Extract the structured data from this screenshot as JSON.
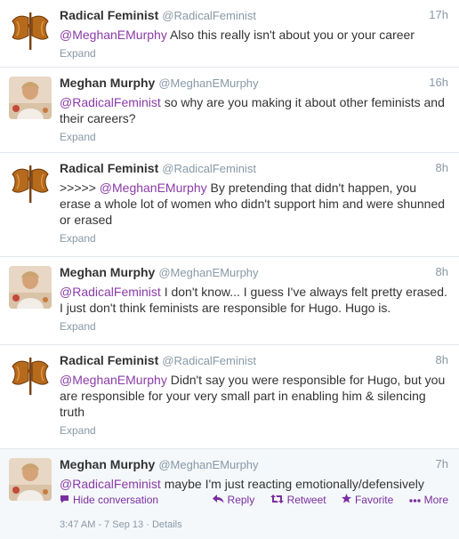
{
  "tweets": [
    {
      "name": "Radical Feminist",
      "handle": "@RadicalFeminist",
      "time": "17h",
      "prefix": "",
      "mention": "@MeghanEMurphy",
      "body": " Also this really isn't about you or your career",
      "expand": "Expand",
      "avatar": "labrys-icon"
    },
    {
      "name": "Meghan Murphy",
      "handle": "@MeghanEMurphy",
      "time": "16h",
      "prefix": "",
      "mention": "@RadicalFeminist",
      "body": " so why are you making it about other feminists and their careers?",
      "expand": "Expand",
      "avatar": "photo"
    },
    {
      "name": "Radical Feminist",
      "handle": "@RadicalFeminist",
      "time": "8h",
      "prefix": ">>>>> ",
      "mention": "@MeghanEMurphy",
      "body": " By pretending that didn't happen, you erase a whole lot of women who didn't support him and were shunned or erased",
      "expand": "Expand",
      "avatar": "labrys-icon"
    },
    {
      "name": "Meghan Murphy",
      "handle": "@MeghanEMurphy",
      "time": "8h",
      "prefix": "",
      "mention": "@RadicalFeminist",
      "body": " I don't know... I guess I've always felt pretty erased. I just don't think feminists are responsible for Hugo. Hugo is.",
      "expand": "Expand",
      "avatar": "photo"
    },
    {
      "name": "Radical Feminist",
      "handle": "@RadicalFeminist",
      "time": "8h",
      "prefix": "",
      "mention": "@MeghanEMurphy",
      "body": " Didn't say you were responsible for Hugo, but you are responsible for your very small part in enabling him & silencing truth",
      "expand": "Expand",
      "avatar": "labrys-icon"
    },
    {
      "name": "Meghan Murphy",
      "handle": "@MeghanEMurphy",
      "time": "7h",
      "prefix": "",
      "mention": "@RadicalFeminist",
      "body": " maybe I'm just reacting emotionally/defensively",
      "expand": "",
      "avatar": "photo"
    }
  ],
  "actions": {
    "hide": "Hide conversation",
    "reply": "Reply",
    "retweet": "Retweet",
    "favorite": "Favorite",
    "more": "More"
  },
  "footer": {
    "timestamp": "3:47 AM - 7 Sep 13",
    "separator": " · ",
    "details": "Details"
  },
  "colors": {
    "mention": "#8b3ba8",
    "action": "#7a2ea0",
    "muted": "#8899a6"
  }
}
